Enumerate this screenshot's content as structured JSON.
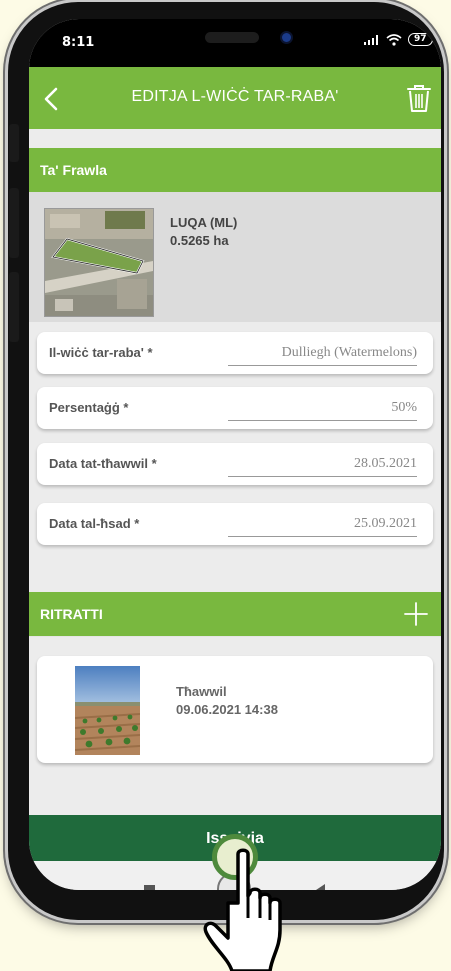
{
  "status_bar": {
    "time": "8:11",
    "battery": "97"
  },
  "header": {
    "title": "EDITJA L-WIĊĊ TAR-RABA'"
  },
  "field": {
    "section_title": "Ta' Frawla",
    "location": "LUQA (ML)",
    "area": "0.5265 ha"
  },
  "form": {
    "fields": [
      {
        "label": "Il-wiċċ tar-raba' *",
        "value": "Dulliegh (Watermelons)"
      },
      {
        "label": "Persentaġġ *",
        "value": "50%"
      },
      {
        "label": "Data tat-tħawwil *",
        "value": "28.05.2021"
      },
      {
        "label": "Data tal-ħsad *",
        "value": "25.09.2021"
      }
    ]
  },
  "photos": {
    "section_title": "RITRATTI",
    "items": [
      {
        "label": "Tħawwil",
        "date": "09.06.2021 14:38"
      }
    ]
  },
  "save_button": {
    "label": "Issejvja"
  },
  "colors": {
    "primary_green": "#79b83f",
    "dark_green": "#1f6a3c",
    "background": "#ececec"
  },
  "icons": [
    "back-arrow-icon",
    "trash-icon",
    "plus-icon",
    "nav-recents-icon",
    "nav-home-icon",
    "nav-back-icon",
    "pointing-hand-icon"
  ]
}
